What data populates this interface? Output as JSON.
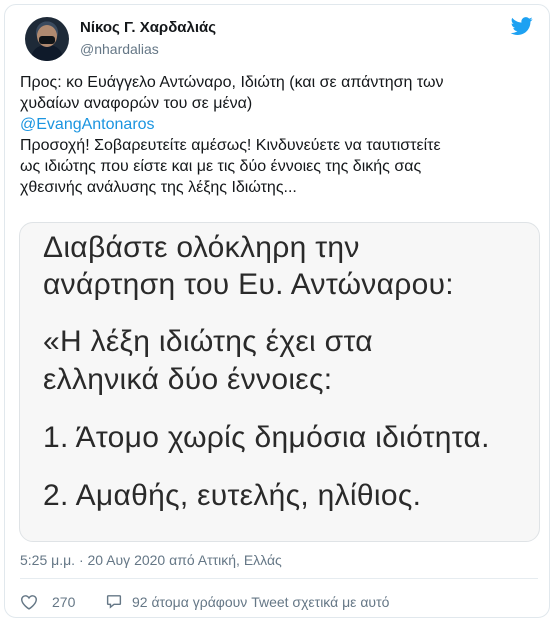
{
  "author": {
    "name": "Νίκος Γ. Χαρδαλιάς",
    "handle": "@nhardalias"
  },
  "icons": {
    "avatar": "profile-photo",
    "brand": "twitter-bird-icon",
    "like": "heart-icon",
    "reply": "speech-bubble-icon"
  },
  "colors": {
    "link": "#1b95e0",
    "brand": "#1da1f2",
    "secondary_text": "#657786"
  },
  "tweet": {
    "line1": "Προς: κο Ευάγγελο Αντώναρο, Ιδιώτη (και σε απάντηση των",
    "line2": "χυδαίων αναφορών του σε μένα)",
    "mention": "@EvangAntonaros",
    "line3": "Προσοχή! Σοβαρευτείτε αμέσως! Κινδυνεύετε να ταυτιστείτε",
    "line4": "ως ιδιώτης που είστε και με τις δύο έννοιες της δικής σας",
    "line5": "χθεσινής ανάλυσης της λέξης Ιδιώτης..."
  },
  "media": {
    "line1": "Διαβάστε ολόκληρη την",
    "line2": "ανάρτηση του Ευ. Αντώναρου:",
    "line3": "«Η λέξη ιδιώτης έχει στα",
    "line4": "ελληνικά δύο έννοιες:",
    "line5": "1. Άτομο χωρίς δημόσια ιδιότητα.",
    "line6": "2. Αμαθής, ευτελής, ηλίθιος."
  },
  "timestamp": "5:25 μ.μ. · 20 Αυγ 2020 από Αττική, Ελλάς",
  "engagement": {
    "likes": "270",
    "talking": "92 άτομα γράφουν Tweet σχετικά με αυτό"
  }
}
